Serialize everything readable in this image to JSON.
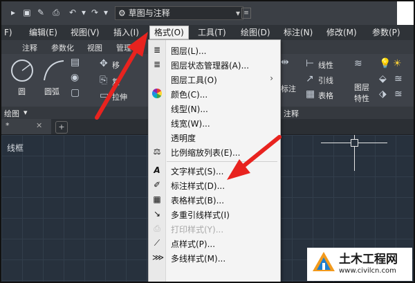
{
  "title_bar": {
    "workspace": "草图与注释",
    "buttons": [
      "save-icon",
      "saveas-icon",
      "print-icon",
      "undo-icon",
      "redo-icon"
    ]
  },
  "menubar": {
    "items": [
      "F)",
      "编辑(E)",
      "视图(V)",
      "插入(I)",
      "格式(O)",
      "工具(T)",
      "绘图(D)",
      "标注(N)",
      "修改(M)",
      "参数(P)"
    ]
  },
  "tabs": [
    "注释",
    "参数化",
    "视图",
    "管理"
  ],
  "ribbon": {
    "circle": "圆",
    "arc": "圆弧",
    "move": "移",
    "copy": "复",
    "stretch": "拉伸",
    "annotate": "标注",
    "linear": "线性",
    "leader": "引线",
    "table": "表格",
    "layer_props_1": "图层",
    "layer_props_2": "特性"
  },
  "panelbar": {
    "draw": "绘图",
    "annotate": "注释"
  },
  "filetab": {
    "label": "*"
  },
  "canvas": {
    "viewport_label": "线框"
  },
  "format_menu": {
    "items": [
      {
        "icon": "layer-icon",
        "label": "图层(L)...",
        "disabled": false,
        "submenu": false
      },
      {
        "icon": "layer-state-icon",
        "label": "图层状态管理器(A)...",
        "disabled": false,
        "submenu": false
      },
      {
        "icon": "",
        "label": "图层工具(O)",
        "disabled": false,
        "submenu": true
      },
      {
        "icon": "color-wheel-icon",
        "label": "颜色(C)...",
        "disabled": false,
        "submenu": false
      },
      {
        "icon": "",
        "label": "线型(N)...",
        "disabled": false,
        "submenu": false
      },
      {
        "icon": "",
        "label": "线宽(W)...",
        "disabled": false,
        "submenu": false
      },
      {
        "icon": "",
        "label": "透明度",
        "disabled": false,
        "submenu": false
      },
      {
        "icon": "scale-list-icon",
        "label": "比例缩放列表(E)...",
        "disabled": false,
        "submenu": false
      },
      {
        "icon": "text-style-icon",
        "label": "文字样式(S)...",
        "disabled": false,
        "submenu": false
      },
      {
        "icon": "dim-style-icon",
        "label": "标注样式(D)...",
        "disabled": false,
        "submenu": false
      },
      {
        "icon": "table-style-icon",
        "label": "表格样式(B)...",
        "disabled": false,
        "submenu": false
      },
      {
        "icon": "mleader-style-icon",
        "label": "多重引线样式(I)",
        "disabled": false,
        "submenu": false
      },
      {
        "icon": "plot-style-icon",
        "label": "打印样式(Y)...",
        "disabled": true,
        "submenu": false
      },
      {
        "icon": "point-style-icon",
        "label": "点样式(P)...",
        "disabled": false,
        "submenu": false
      },
      {
        "icon": "mline-style-icon",
        "label": "多线样式(M)...",
        "disabled": false,
        "submenu": false
      }
    ],
    "submenu_arrow": "›"
  },
  "watermark": {
    "title": "土木工程网",
    "url": "www.civilcn.com"
  },
  "colors": {
    "arrow": "#e8231f",
    "menu_bg": "#f4f4f4",
    "canvas": "#27313d"
  }
}
